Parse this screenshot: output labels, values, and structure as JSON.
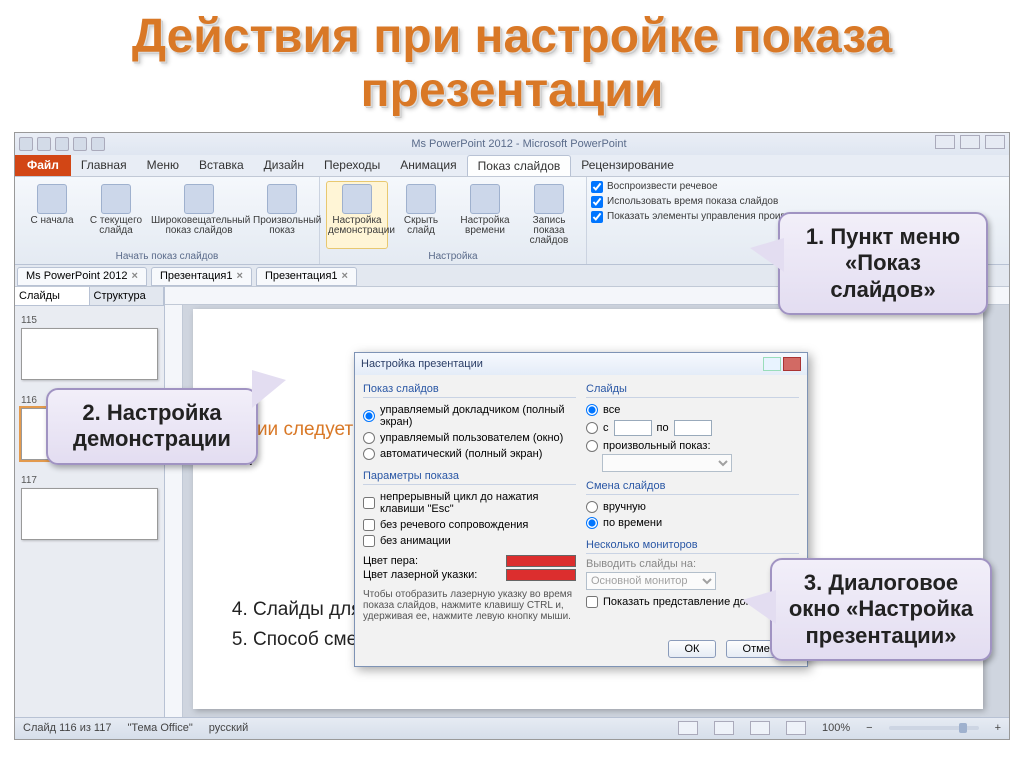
{
  "page_title": "Действия при настройке показа презентации",
  "app_title": "Ms PowerPoint 2012  -  Microsoft PowerPoint",
  "tabs": {
    "file": "Файл",
    "items": [
      "Главная",
      "Меню",
      "Вставка",
      "Дизайн",
      "Переходы",
      "Анимация",
      "Показ слайдов",
      "Рецензирование"
    ],
    "active": "Показ слайдов"
  },
  "ribbon": {
    "group1_title": "Начать показ слайдов",
    "btns1": [
      {
        "label": "С начала"
      },
      {
        "label": "С текущего слайда"
      },
      {
        "label": "Широковещательный показ слайдов"
      },
      {
        "label": "Произвольный показ "
      }
    ],
    "group2_title": "Настройка",
    "btns2": [
      {
        "label": "Настройка демонстрации",
        "hl": true
      },
      {
        "label": "Скрыть слайд"
      },
      {
        "label": "Настройка времени"
      },
      {
        "label": "Запись показа слайдов "
      }
    ],
    "checks": [
      "Воспроизвести речевое",
      "Использовать время показа слайдов",
      "Показать элементы управления проигрывателем"
    ]
  },
  "doc_tabs": [
    "Ms PowerPoint 2012",
    "Презентация1",
    "Презентация1"
  ],
  "sidepanel": {
    "tabs": [
      "Слайды",
      "Структура"
    ],
    "thumbs": [
      "115",
      "116",
      "117"
    ]
  },
  "slide": {
    "line1_a": "тации следует",
    "line1_b": "ее:",
    "items": [
      "",
      "",
      "",
      "Слайды для показа.",
      "Способ смены слайдов."
    ]
  },
  "dialog": {
    "title": "Настройка презентации",
    "fs1": {
      "title": "Показ слайдов",
      "r1": "управляемый докладчиком (полный экран)",
      "r2": "управляемый пользователем (окно)",
      "r3": "автоматический (полный экран)"
    },
    "fs2": {
      "title": "Параметры показа",
      "c1": "непрерывный цикл до нажатия клавиши \"Esc\"",
      "c2": "без речевого сопровождения",
      "c3": "без анимации",
      "pen": "Цвет пера:",
      "laser": "Цвет лазерной указки:"
    },
    "fs3": {
      "title": "Слайды",
      "r1": "все",
      "r2": "с",
      "to": "по",
      "r3": "произвольный показ:"
    },
    "fs4": {
      "title": "Смена слайдов",
      "r1": "вручную",
      "r2": "по времени"
    },
    "fs5": {
      "title": "Несколько мониторов",
      "lbl": "Выводить слайды на:",
      "sel": "Основной монитор",
      "chk": "Показать представление докладчика"
    },
    "hint": "Чтобы отобразить лазерную указку во время показа слайдов, нажмите клавишу CTRL и, удерживая ее, нажмите левую кнопку мыши.",
    "ok": "ОК",
    "cancel": "Отмена"
  },
  "status": {
    "slide": "Слайд 116 из 117",
    "theme": "\"Тема Office\"",
    "lang": "русский",
    "zoom": "100%"
  },
  "callouts": {
    "c1": "1. Пункт меню «Показ слайдов»",
    "c2": "2. Настройка демонстрации",
    "c3": "3. Диалоговое окно «Настройка презентации»"
  }
}
